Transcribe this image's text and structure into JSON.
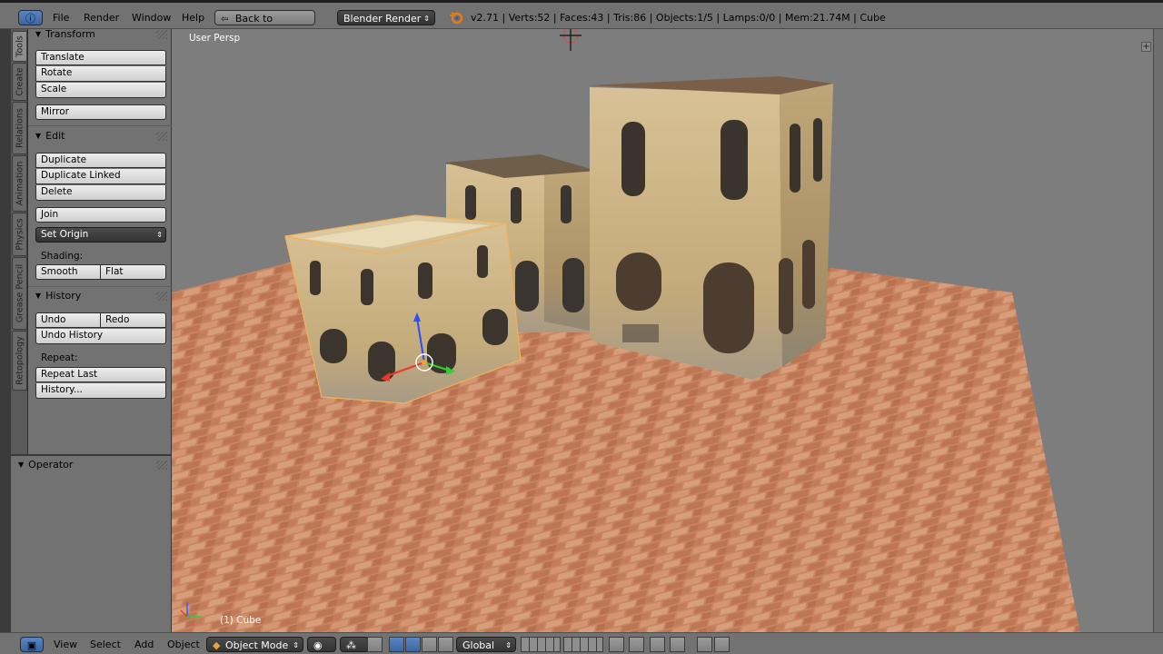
{
  "top_header": {
    "menus": [
      "File",
      "Render",
      "Window",
      "Help"
    ],
    "back_button": "Back to Previous",
    "render_engine": "Blender Render",
    "stats": "v2.71 | Verts:52 | Faces:43 | Tris:86 | Objects:1/5 | Lamps:0/0 | Mem:21.74M | Cube"
  },
  "side_tabs": [
    "Tools",
    "Create",
    "Relations",
    "Animation",
    "Physics",
    "Grease Pencil",
    "Retopology"
  ],
  "tool_shelf": {
    "transform": {
      "title": "Transform",
      "translate": "Translate",
      "rotate": "Rotate",
      "scale": "Scale",
      "mirror": "Mirror"
    },
    "edit": {
      "title": "Edit",
      "duplicate": "Duplicate",
      "duplicate_linked": "Duplicate Linked",
      "delete": "Delete",
      "join": "Join",
      "set_origin": "Set Origin",
      "shading_label": "Shading:",
      "smooth": "Smooth",
      "flat": "Flat"
    },
    "history": {
      "title": "History",
      "undo": "Undo",
      "redo": "Redo",
      "undo_history": "Undo History",
      "repeat_label": "Repeat:",
      "repeat_last": "Repeat Last",
      "history": "History..."
    }
  },
  "operator_panel": {
    "title": "Operator"
  },
  "viewport": {
    "view_label": "User Persp",
    "object_label": "(1) Cube"
  },
  "bottom_header": {
    "menus": [
      "View",
      "Select",
      "Add",
      "Object"
    ],
    "mode": "Object Mode",
    "orientation": "Global"
  },
  "colors": {
    "ui_grey": "#727272",
    "viewport_grey": "#7d7d7d",
    "active_blue": "#4a75b3",
    "floor_brick": "#c47f5c",
    "building_stucco": "#cbb487"
  }
}
